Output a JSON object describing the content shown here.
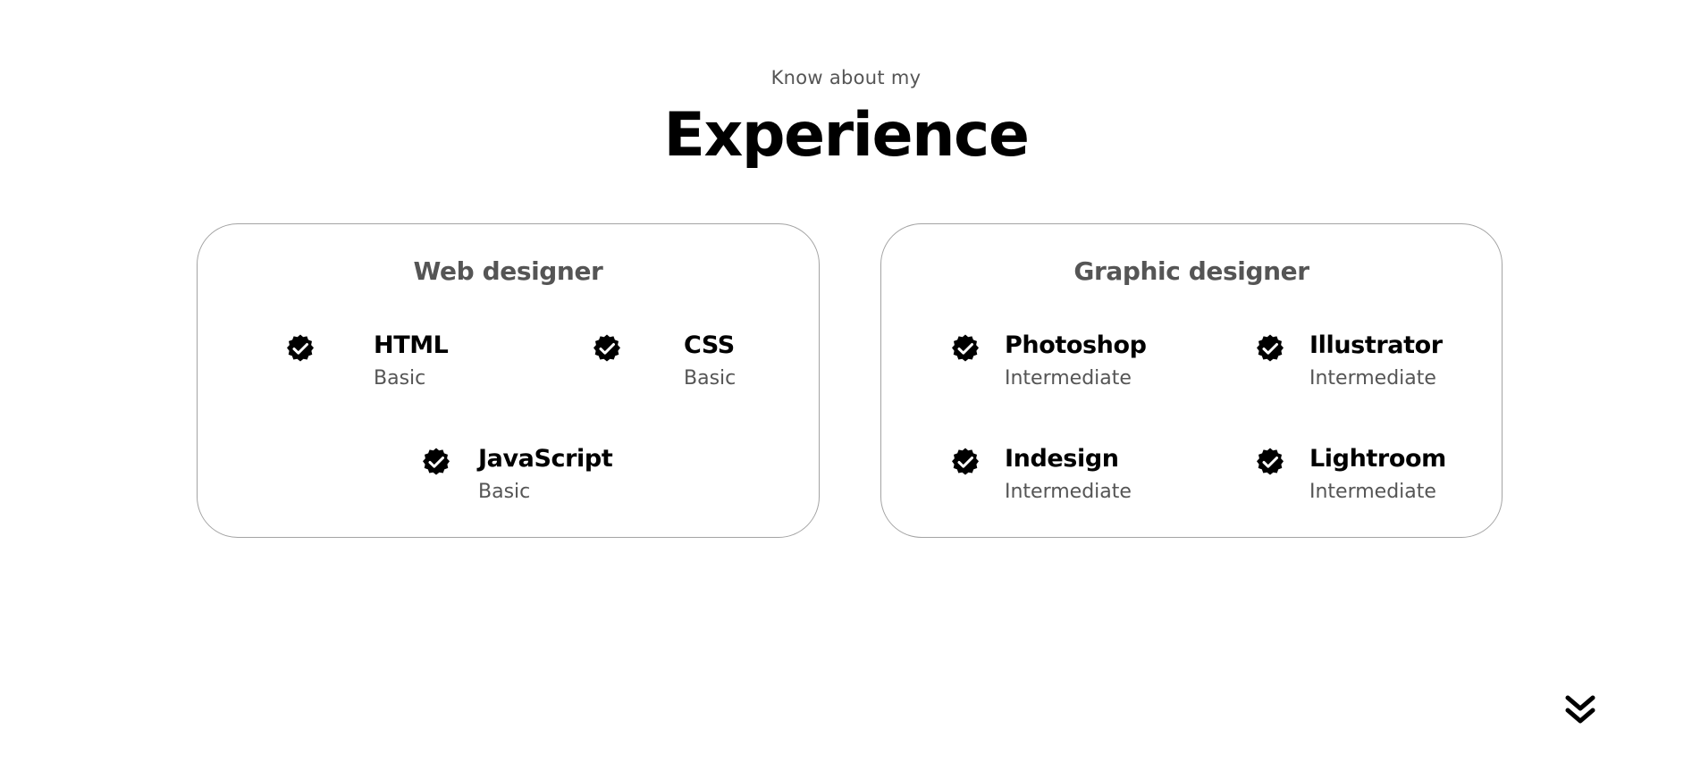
{
  "section": {
    "kicker": "Know about my",
    "title": "Experience"
  },
  "cards": [
    {
      "title": "Web designer",
      "skills": [
        {
          "name": "HTML",
          "level": "Basic"
        },
        {
          "name": "CSS",
          "level": "Basic"
        },
        {
          "name": "JavaScript",
          "level": "Basic"
        }
      ]
    },
    {
      "title": "Graphic designer",
      "skills": [
        {
          "name": "Photoshop",
          "level": "Intermediate"
        },
        {
          "name": "Illustrator",
          "level": "Intermediate"
        },
        {
          "name": "Indesign",
          "level": "Intermediate"
        },
        {
          "name": "Lightroom",
          "level": "Intermediate"
        }
      ]
    }
  ],
  "icons": {
    "skill_badge": "verified-check-icon",
    "scroll": "double-chevron-down-icon"
  },
  "colors": {
    "text_primary": "#000000",
    "text_secondary": "#555555",
    "card_border": "#a3a3a3",
    "background": "#ffffff"
  }
}
